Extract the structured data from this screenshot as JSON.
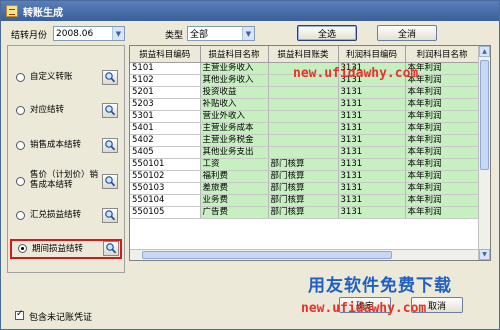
{
  "window": {
    "title": "转账生成"
  },
  "toolbar": {
    "period_label": "结转月份",
    "period_value": "2008.06",
    "type_label": "类型",
    "type_value": "全部",
    "select_all_label": "全选",
    "clear_all_label": "全消"
  },
  "options": [
    {
      "label": "自定义转账",
      "selected": false
    },
    {
      "label": "对应结转",
      "selected": false
    },
    {
      "label": "销售成本结转",
      "selected": false
    },
    {
      "label": "售价（计划价）销售成本结转",
      "selected": false
    },
    {
      "label": "汇兑损益结转",
      "selected": false
    },
    {
      "label": "期间损益结转",
      "selected": true
    }
  ],
  "grid": {
    "columns": [
      "损益科目编码",
      "损益科目名称",
      "损益科目账类",
      "利润科目编码",
      "利润科目名称"
    ],
    "rows": [
      [
        "5101",
        "主营业务收入",
        "",
        "3131",
        "本年利润"
      ],
      [
        "5102",
        "其他业务收入",
        "",
        "3131",
        "本年利润"
      ],
      [
        "5201",
        "投资收益",
        "",
        "3131",
        "本年利润"
      ],
      [
        "5203",
        "补贴收入",
        "",
        "3131",
        "本年利润"
      ],
      [
        "5301",
        "营业外收入",
        "",
        "3131",
        "本年利润"
      ],
      [
        "5401",
        "主营业务成本",
        "",
        "3131",
        "本年利润"
      ],
      [
        "5402",
        "主营业务税金",
        "",
        "3131",
        "本年利润"
      ],
      [
        "5405",
        "其他业务支出",
        "",
        "3131",
        "本年利润"
      ],
      [
        "550101",
        "工资",
        "部门核算",
        "3131",
        "本年利润"
      ],
      [
        "550102",
        "福利费",
        "部门核算",
        "3131",
        "本年利润"
      ],
      [
        "550103",
        "差旅费",
        "部门核算",
        "3131",
        "本年利润"
      ],
      [
        "550104",
        "业务费",
        "部门核算",
        "3131",
        "本年利润"
      ],
      [
        "550105",
        "广告费",
        "部门核算",
        "3131",
        "本年利润"
      ]
    ]
  },
  "footer": {
    "include_unposted_label": "包含未记账凭证",
    "ok_label": "确定",
    "cancel_label": "取消"
  },
  "watermarks": {
    "url_top": "new.ufidawhy.com",
    "promo": "用友软件免费下载",
    "url_bottom": "new.ufidawhy.com"
  }
}
